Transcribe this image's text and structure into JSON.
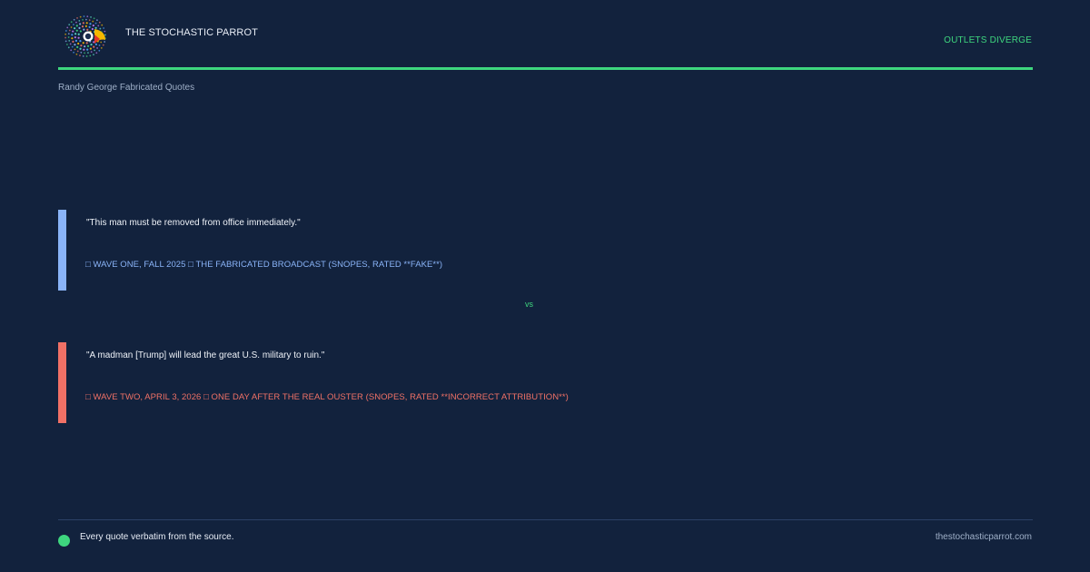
{
  "header": {
    "brand": "THE STOCHASTIC PARROT",
    "verdict": "OUTLETS DIVERGE",
    "topic": "Randy George Fabricated Quotes"
  },
  "quotes": [
    {
      "text": "\"This man must be removed from office immediately.\"",
      "source": "□ WAVE ONE, FALL 2025 □ THE FABRICATED BROADCAST (SNOPES, RATED **FAKE**)",
      "accent": "#8ab4f8"
    },
    {
      "text": "\"A madman [Trump] will lead the great U.S. military to ruin.\"",
      "source": "□ WAVE TWO, APRIL 3, 2026 □ ONE DAY AFTER THE REAL OUSTER (SNOPES, RATED **INCORRECT ATTRIBUTION**)",
      "accent": "#f07166"
    }
  ],
  "separator": "vs",
  "footer": {
    "note": "Every quote verbatim from the source.",
    "site": "thestochasticparrot.com"
  },
  "colors": {
    "background": "#12223d",
    "accent_green": "#3ed67e",
    "blue": "#8ab4f8",
    "red": "#f07166"
  },
  "icons": {
    "logo": "parrot-logo-icon",
    "footer_dot": "green-dot-icon"
  }
}
